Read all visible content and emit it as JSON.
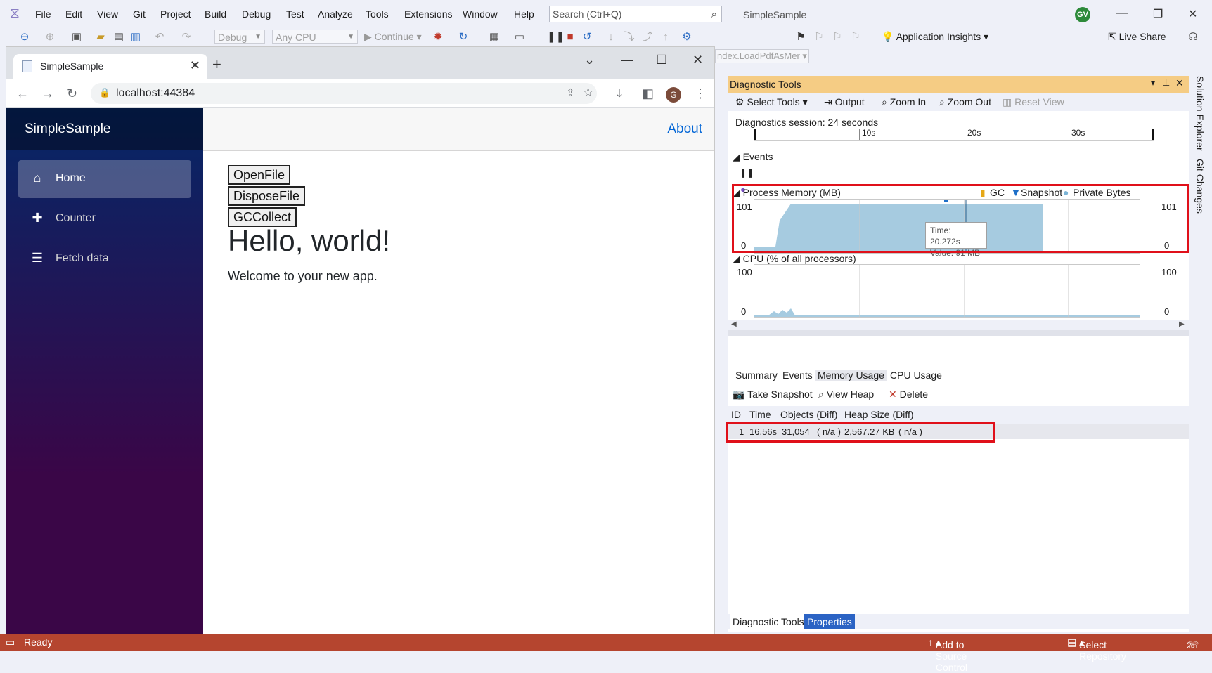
{
  "vs": {
    "menu": [
      "File",
      "Edit",
      "View",
      "Git",
      "Project",
      "Build",
      "Debug",
      "Test",
      "Analyze",
      "Tools",
      "Extensions",
      "Window",
      "Help"
    ],
    "search_placeholder": "Search (Ctrl+Q)",
    "solution_title": "SimpleSample",
    "avatar_initials": "GV",
    "toolbar": {
      "config": "Debug",
      "platform": "Any CPU",
      "continue_label": "Continue",
      "app_insights": "Application Insights",
      "live_share": "Live Share",
      "editor_tab_fragment": "ndex.LoadPdfAsMer"
    },
    "status": {
      "ready": "Ready",
      "add_source": "Add to Source Control",
      "select_repo": "Select Repository",
      "notifications": "2"
    }
  },
  "browser": {
    "tab_title": "SimpleSample",
    "url": "localhost:44384",
    "profile_initial": "G"
  },
  "app": {
    "brand": "SimpleSample",
    "nav": [
      {
        "label": "Home",
        "icon": "home-icon"
      },
      {
        "label": "Counter",
        "icon": "plus-icon"
      },
      {
        "label": "Fetch data",
        "icon": "list-icon"
      }
    ],
    "about": "About",
    "buttons": [
      "OpenFile",
      "DisposeFile",
      "GCCollect"
    ],
    "heading": "Hello, world!",
    "welcome": "Welcome to your new app."
  },
  "diag": {
    "title": "Diagnostic Tools",
    "toolbar": [
      "Select Tools",
      "Output",
      "Zoom In",
      "Zoom Out",
      "Reset View"
    ],
    "session": "Diagnostics session: 24 seconds",
    "ticks": [
      "10s",
      "20s",
      "30s"
    ],
    "events_title": "Events",
    "memory_title": "Process Memory (MB)",
    "legend": [
      "GC",
      "Snapshot",
      "Private Bytes"
    ],
    "memory_max": "101",
    "memory_min": "0",
    "tooltip_time": "Time: 20.272s",
    "tooltip_value": "Value: 91 MB",
    "cpu_title": "CPU (% of all processors)",
    "cpu_max": "100",
    "cpu_min": "0",
    "bottom_tabs": [
      "Summary",
      "Events",
      "Memory Usage",
      "CPU Usage"
    ],
    "actions": [
      "Take Snapshot",
      "View Heap",
      "Delete"
    ],
    "columns": [
      "ID",
      "Time",
      "Objects (Diff)",
      "Heap Size (Diff)"
    ],
    "row": {
      "id": "1",
      "time": "16.56s",
      "objects": "31,054",
      "objects_diff": "( n/a )",
      "heap": "2,567.27 KB",
      "heap_diff": "( n/a )"
    },
    "panel_tabs": [
      "Diagnostic Tools",
      "Properties"
    ],
    "rail": [
      "Solution Explorer",
      "Git Changes"
    ]
  },
  "colors": {
    "status_bar": "#b5452f",
    "highlight_box": "#e0101a",
    "memory_fill": "#a6cbe0",
    "diag_header": "#f5cc84"
  }
}
